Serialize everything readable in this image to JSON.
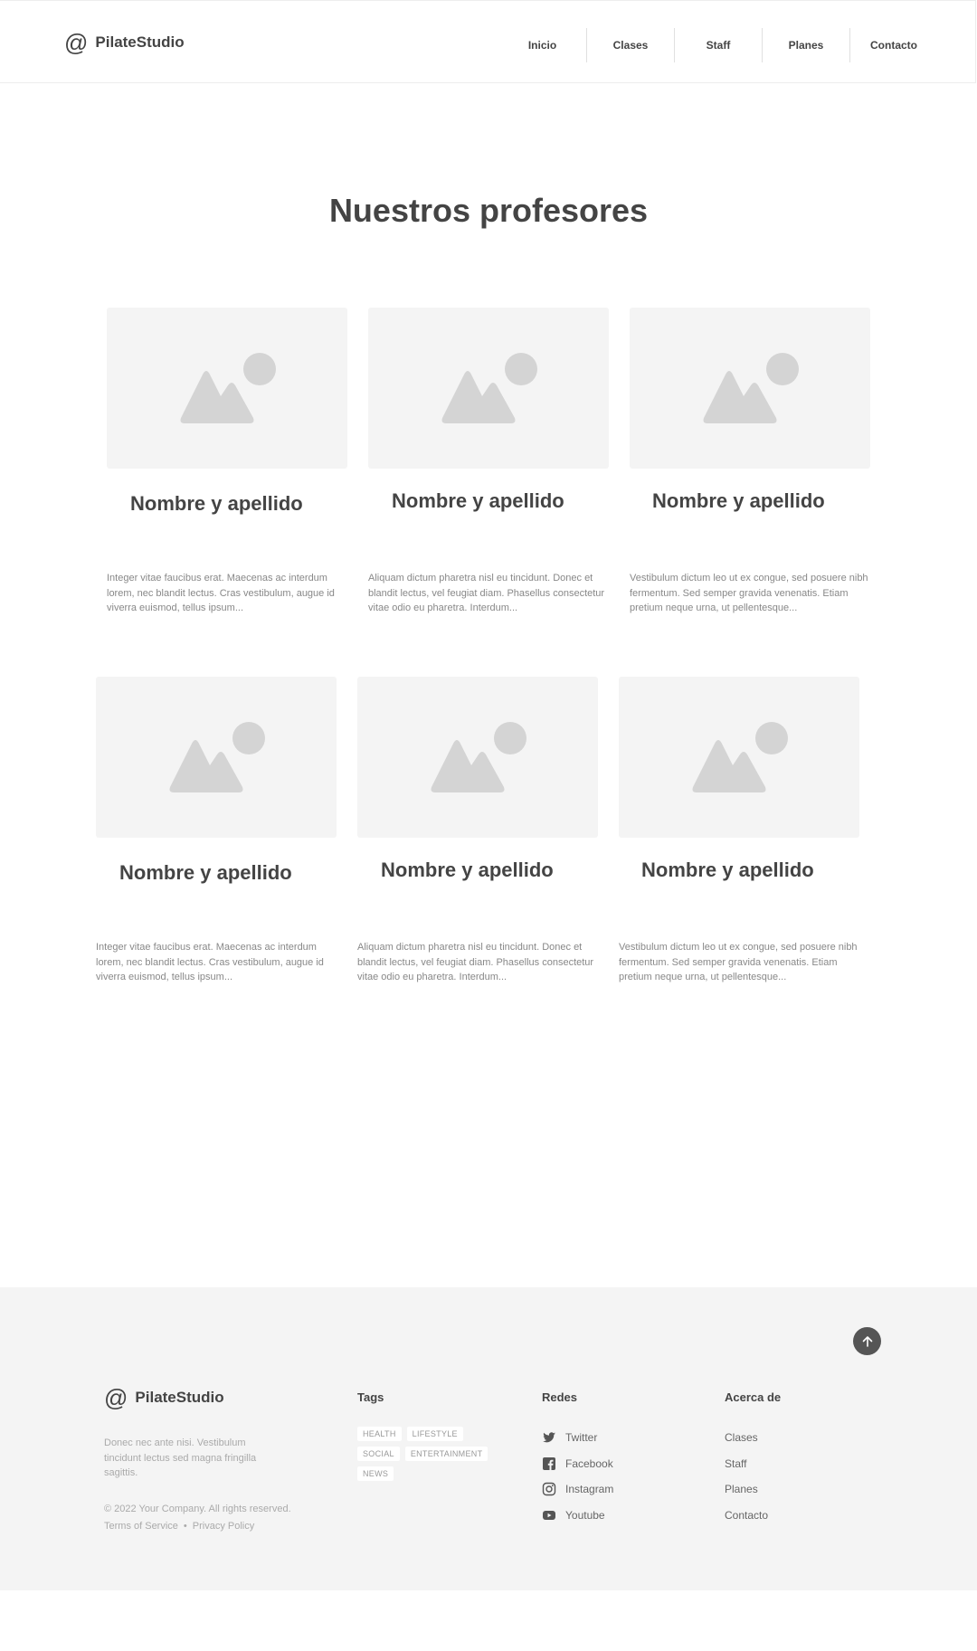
{
  "header": {
    "logo_text": "PilateStudio",
    "nav": [
      "Inicio",
      "Clases",
      "Staff",
      "Planes",
      "Contacto"
    ]
  },
  "main": {
    "title": "Nuestros profesores",
    "cards": [
      {
        "name": "Nombre y apellido",
        "desc": "Integer vitae faucibus erat. Maecenas ac interdum lorem, nec blandit lectus. Cras vestibulum, augue id viverra euismod, tellus ipsum..."
      },
      {
        "name": "Nombre y apellido",
        "desc": "Aliquam dictum pharetra nisl eu tincidunt. Donec et blandit lectus, vel feugiat diam. Phasellus consectetur vitae odio eu pharetra. Interdum..."
      },
      {
        "name": "Nombre y apellido",
        "desc": "Vestibulum dictum leo ut ex congue, sed posuere nibh fermentum. Sed semper gravida venenatis. Etiam pretium neque urna, ut pellentesque..."
      },
      {
        "name": "Nombre y apellido",
        "desc": "Integer vitae faucibus erat. Maecenas ac interdum lorem, nec blandit lectus. Cras vestibulum, augue id viverra euismod, tellus ipsum..."
      },
      {
        "name": "Nombre y apellido",
        "desc": "Aliquam dictum pharetra nisl eu tincidunt. Donec et blandit lectus, vel feugiat diam. Phasellus consectetur vitae odio eu pharetra. Interdum..."
      },
      {
        "name": "Nombre y apellido",
        "desc": "Vestibulum dictum leo ut ex congue, sed posuere nibh fermentum. Sed semper gravida venenatis. Etiam pretium neque urna, ut pellentesque..."
      }
    ]
  },
  "footer": {
    "logo_text": "PilateStudio",
    "description": "Donec nec ante nisi. Vestibulum tincidunt lectus sed magna fringilla sagittis.",
    "copyright": "© 2022 Your Company.  All rights reserved.",
    "terms": "Terms of Service",
    "separator": "•",
    "privacy": "Privacy Policy",
    "tags_title": "Tags",
    "tags": [
      "HEALTH",
      "LIFESTYLE",
      "SOCIAL",
      "ENTERTAINMENT",
      "NEWS"
    ],
    "social_title": "Redes",
    "social": [
      {
        "label": "Twitter",
        "icon": "twitter-icon"
      },
      {
        "label": "Facebook",
        "icon": "facebook-icon"
      },
      {
        "label": "Instagram",
        "icon": "instagram-icon"
      },
      {
        "label": "Youtube",
        "icon": "youtube-icon"
      }
    ],
    "about_title": "Acerca de",
    "about": [
      "Clases",
      "Staff",
      "Planes",
      "Contacto"
    ]
  }
}
